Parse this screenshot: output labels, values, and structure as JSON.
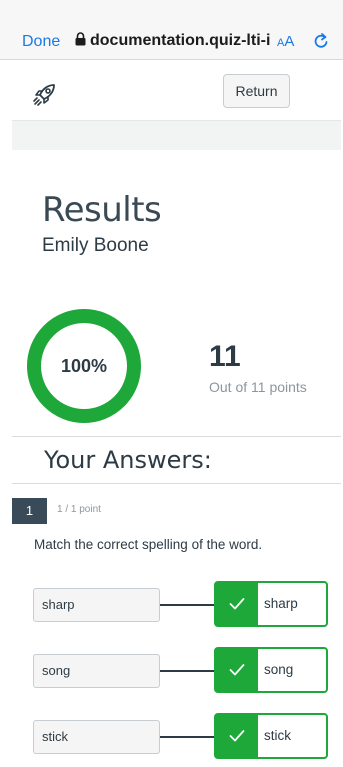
{
  "browser": {
    "done_label": "Done",
    "url": "documentation.quiz-lti-ia",
    "text_size_small": "A",
    "text_size_large": "A",
    "accent_color": "#1a7ae6"
  },
  "header": {
    "logo_icon": "rocket-icon",
    "return_label": "Return"
  },
  "results": {
    "title": "Results",
    "student_name": "Emily Boone",
    "score_percent_label": "100%",
    "score_fraction": 1.0,
    "points_earned": "11",
    "points_out_of": "Out of 11 points",
    "ring_color": "#1fa83a"
  },
  "answers": {
    "heading": "Your Answers:",
    "question": {
      "number": "1",
      "points": "1 / 1 point",
      "prompt": "Match the correct spelling of the word.",
      "matches": [
        {
          "left": "sharp",
          "right": "sharp",
          "status": "correct"
        },
        {
          "left": "song",
          "right": "song",
          "status": "correct"
        },
        {
          "left": "stick",
          "right": "stick",
          "status": "correct"
        }
      ]
    }
  }
}
